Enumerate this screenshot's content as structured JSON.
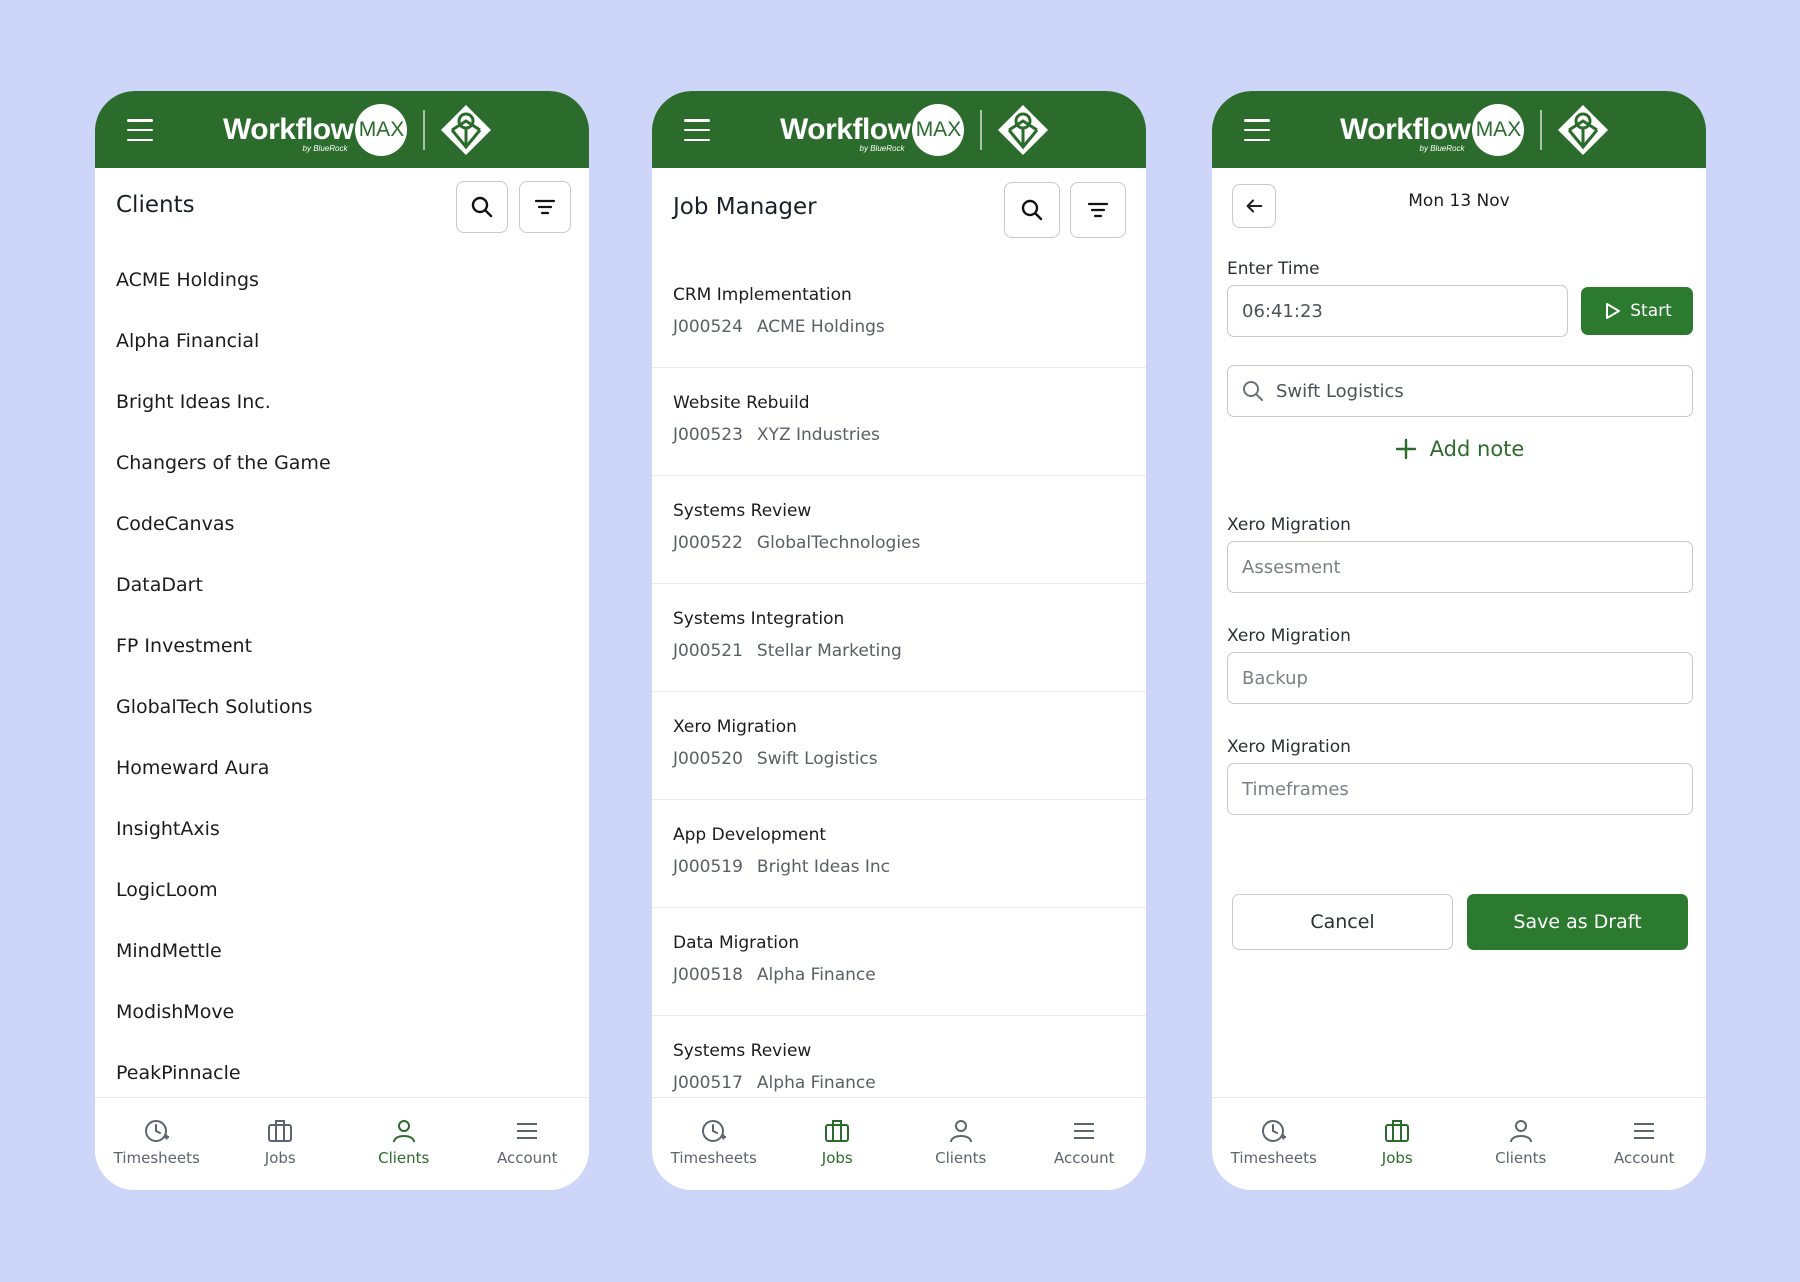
{
  "brand": {
    "name": "Workflow",
    "badge": "MAX",
    "tagline": "by BlueRock"
  },
  "nav": {
    "timesheets": "Timesheets",
    "jobs": "Jobs",
    "clients": "Clients",
    "account": "Account"
  },
  "colors": {
    "brand_green": "#2b6b2b",
    "background": "#cdd6f8",
    "muted": "#5d6470"
  },
  "clients_screen": {
    "title": "Clients",
    "active_tab": "clients",
    "items": [
      "ACME Holdings",
      "Alpha Financial",
      "Bright Ideas Inc.",
      "Changers of the Game",
      "CodeCanvas",
      "DataDart",
      "FP Investment",
      "GlobalTech Solutions",
      "Homeward Aura",
      "InsightAxis",
      "LogicLoom",
      "MindMettle",
      "ModishMove",
      "PeakPinnacle"
    ]
  },
  "jobs_screen": {
    "title": "Job Manager",
    "active_tab": "jobs",
    "items": [
      {
        "title": "CRM Implementation",
        "code": "J000524",
        "client": "ACME Holdings"
      },
      {
        "title": "Website Rebuild",
        "code": "J000523",
        "client": "XYZ Industries"
      },
      {
        "title": "Systems Review",
        "code": "J000522",
        "client": "GlobalTechnologies"
      },
      {
        "title": "Systems Integration",
        "code": "J000521",
        "client": "Stellar Marketing"
      },
      {
        "title": "Xero Migration",
        "code": "J000520",
        "client": "Swift Logistics"
      },
      {
        "title": "App Development",
        "code": "J000519",
        "client": "Bright Ideas Inc"
      },
      {
        "title": "Data Migration",
        "code": "J000518",
        "client": "Alpha Finance"
      },
      {
        "title": "Systems Review",
        "code": "J000517",
        "client": "Alpha Finance"
      }
    ]
  },
  "time_screen": {
    "date": "Mon 13 Nov",
    "active_tab": "jobs",
    "enter_time_label": "Enter Time",
    "time_value": "06:41:23",
    "start_label": "Start",
    "client_search_value": "Swift Logistics",
    "add_note_label": "Add note",
    "tasks": [
      {
        "label": "Xero Migration",
        "placeholder": "Assesment"
      },
      {
        "label": "Xero Migration",
        "placeholder": "Backup"
      },
      {
        "label": "Xero Migration",
        "placeholder": "Timeframes"
      }
    ],
    "cancel_label": "Cancel",
    "save_label": "Save as Draft"
  }
}
